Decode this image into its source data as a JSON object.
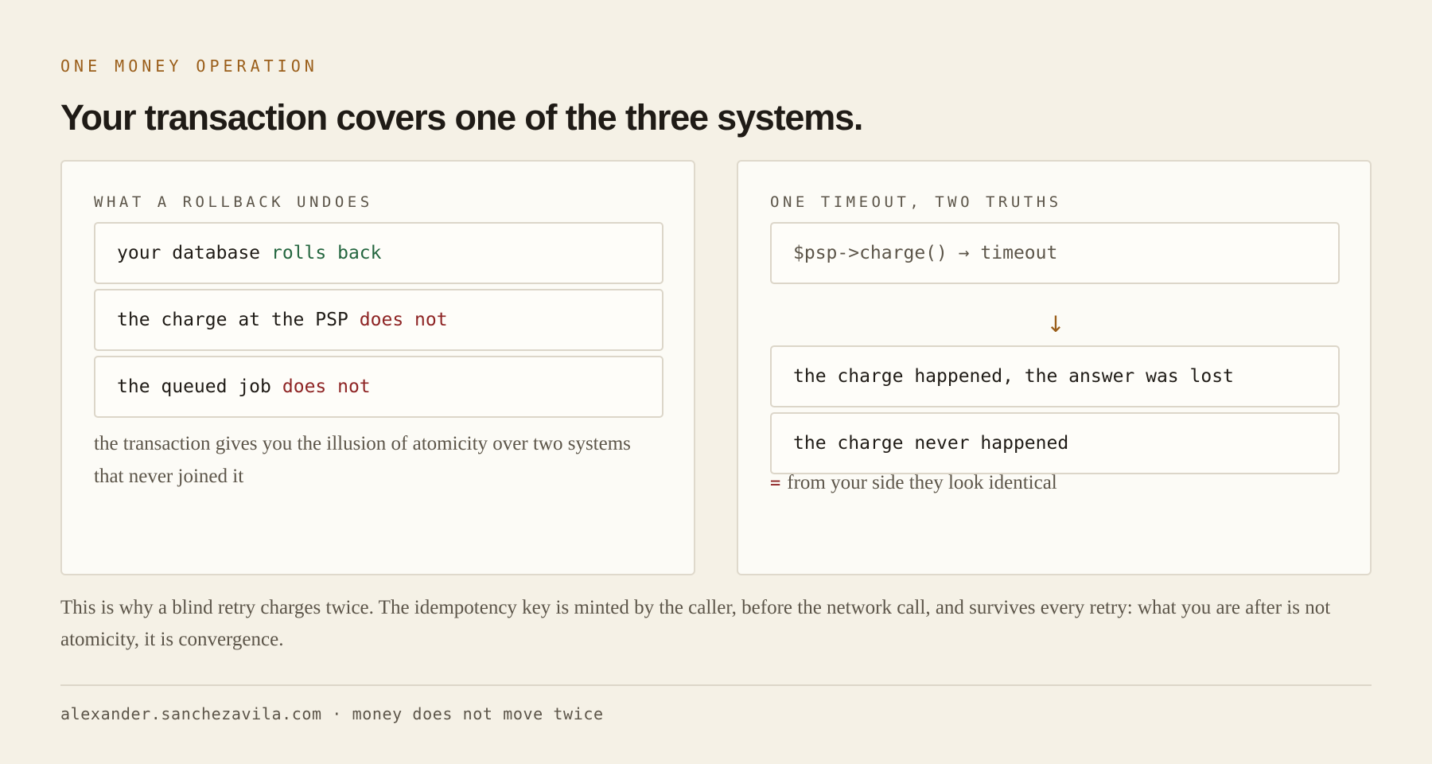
{
  "eyebrow": "ONE MONEY OPERATION",
  "headline": "Your transaction covers one of the three systems.",
  "left_card": {
    "title": "WHAT A ROLLBACK UNDOES",
    "rows": [
      {
        "subject": "your database",
        "verdict": "rolls back",
        "verdict_color": "#24663f"
      },
      {
        "subject": "the charge at the PSP",
        "verdict": "does not",
        "verdict_color": "#8e2424"
      },
      {
        "subject": "the queued job",
        "verdict": "does not",
        "verdict_color": "#8e2424"
      }
    ],
    "note": "the transaction gives you the illusion of atomicity over two systems that never joined it"
  },
  "right_card": {
    "title": "ONE TIMEOUT, TWO TRUTHS",
    "call": "$psp->charge() → timeout",
    "arrow": "↓",
    "outcomes": [
      "the charge happened, the answer was lost",
      "the charge never happened"
    ],
    "equals_sign": "=",
    "note": "from your side they look identical"
  },
  "closing": "This is why a blind retry charges twice. The idempotency key is minted by the caller, before the network call, and survives every retry: what you are after is not atomicity, it is convergence.",
  "footer": "alexander.sanchezavila.com · money does not move twice",
  "colors": {
    "background": "#f5f1e6",
    "accent": "#9a5e1a",
    "success": "#24663f",
    "danger": "#8e2424"
  }
}
